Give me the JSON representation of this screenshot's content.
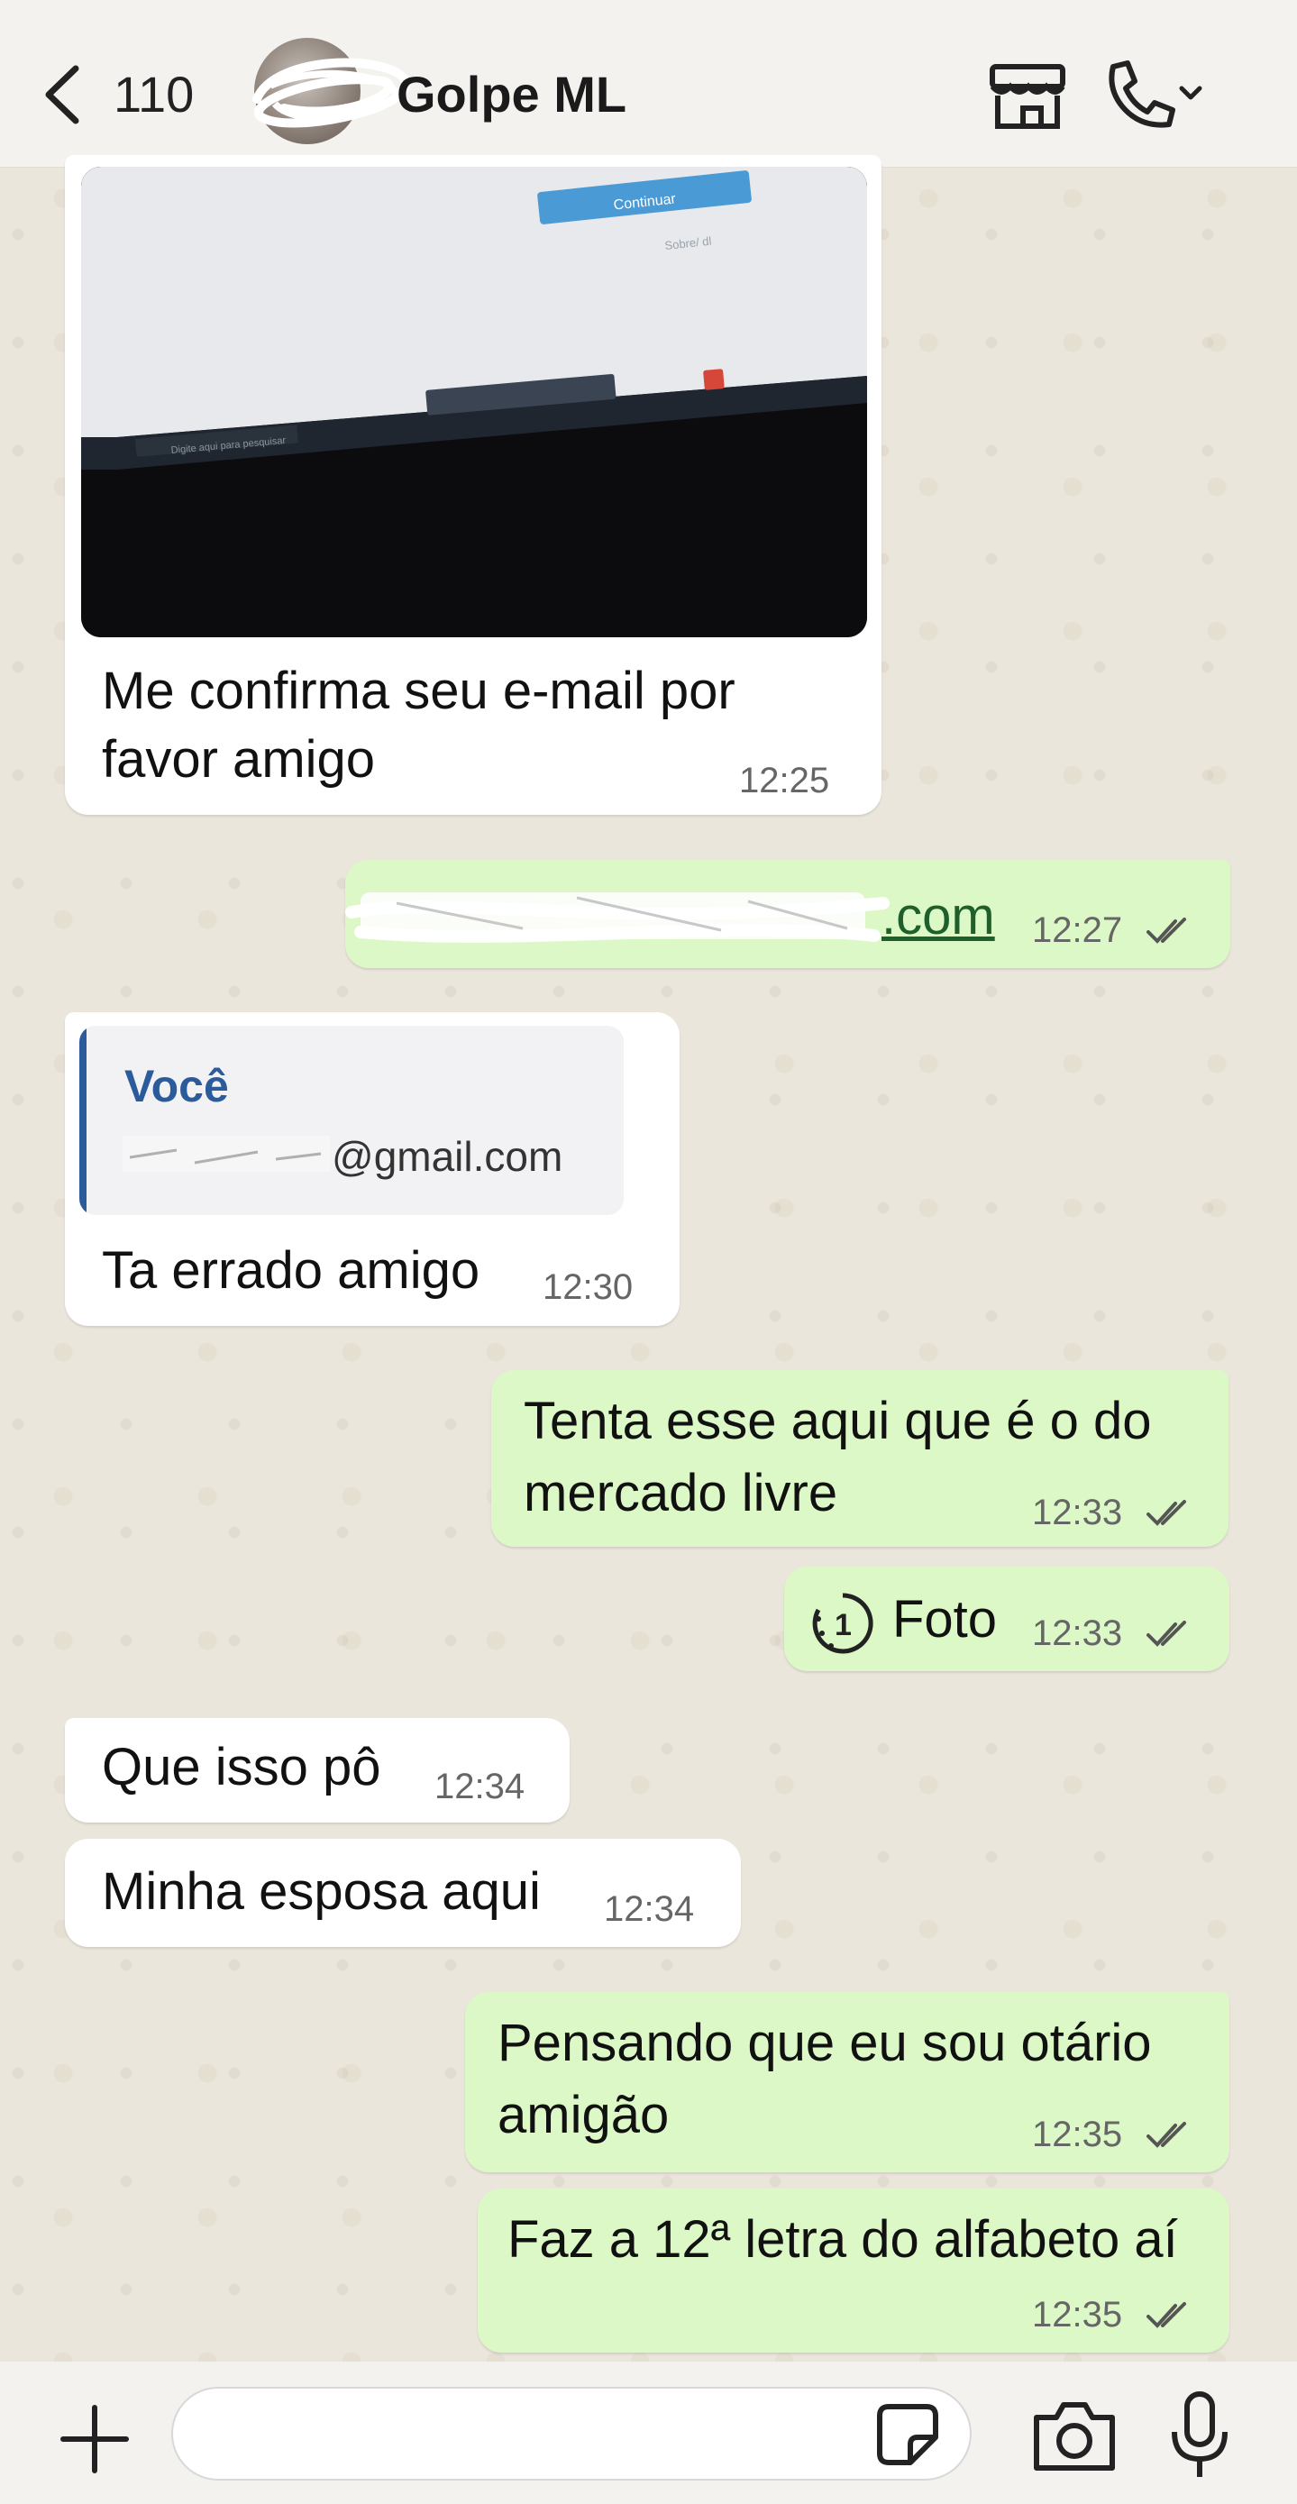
{
  "header": {
    "back_count": "110",
    "contact_name": "Golpe ML"
  },
  "messages": [
    {
      "direction": "in",
      "type": "image_caption",
      "text_line1": "Me confirma seu e-mail por",
      "text_line2": "favor amigo",
      "time": "12:25",
      "image": {
        "button_label": "Continuar",
        "link_label": "Sobre/ dl",
        "search_placeholder": "Digite aqui para pesquisar"
      }
    },
    {
      "direction": "out",
      "text_suffix": ".com",
      "time": "12:27",
      "status": "read"
    },
    {
      "direction": "in",
      "quote_author": "Você",
      "quote_text_suffix": "@gmail.com",
      "text": "Ta errado amigo",
      "time": "12:30"
    },
    {
      "direction": "out",
      "text_line1": "Tenta esse aqui que é o do",
      "text_line2": "mercado livre",
      "time": "12:33",
      "status": "read"
    },
    {
      "direction": "out",
      "type": "view_once",
      "text": "Foto",
      "badge": "1",
      "time": "12:33",
      "status": "read"
    },
    {
      "direction": "in",
      "text": "Que isso pô",
      "time": "12:34"
    },
    {
      "direction": "in",
      "text": "Minha esposa aqui",
      "time": "12:34"
    },
    {
      "direction": "out",
      "text_line1": "Pensando que eu sou otário",
      "text_line2": "amigão",
      "time": "12:35",
      "status": "read"
    },
    {
      "direction": "out",
      "text": "Faz a 12ª letra do alfabeto aí",
      "time": "12:35",
      "status": "read"
    }
  ],
  "composer": {
    "placeholder": ""
  },
  "colors": {
    "incoming": "#ffffff",
    "outgoing": "#dcf8c6",
    "quote_accent": "#2b5b9a",
    "ticks": "#555555"
  },
  "icons": [
    "chevron-left-icon",
    "store-icon",
    "phone-icon",
    "chevron-down-icon",
    "plus-icon",
    "sticker-icon",
    "camera-icon",
    "mic-icon",
    "double-check-icon",
    "view-once-icon"
  ]
}
